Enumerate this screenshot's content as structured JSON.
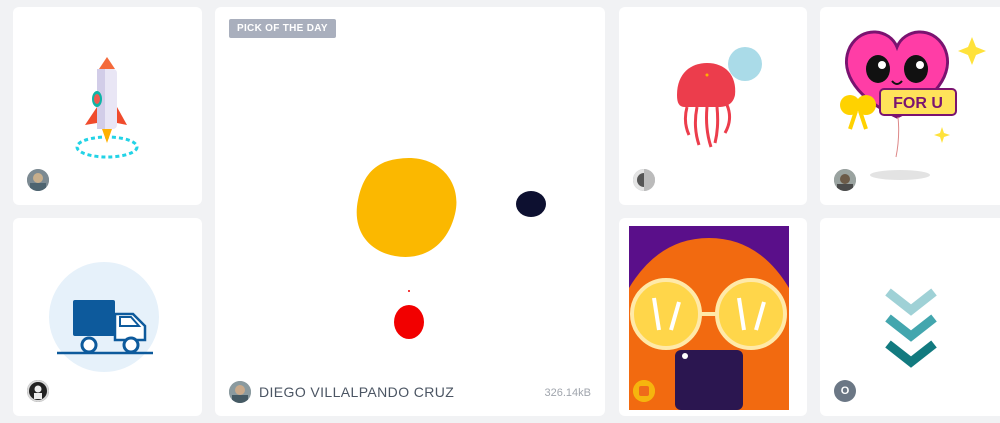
{
  "featured": {
    "badge": "PICK OF THE DAY",
    "author": "DIEGO VILLALPANDO CRUZ",
    "file_size": "326.14kB"
  },
  "cards": [
    {
      "id": "rocket",
      "icon": "rocket-icon"
    },
    {
      "id": "truck",
      "icon": "delivery-truck-icon"
    },
    {
      "id": "jellyfish",
      "icon": "jellyfish-icon"
    },
    {
      "id": "heart",
      "icon": "heart-for-u-icon",
      "text": "FOR U"
    },
    {
      "id": "glasses",
      "icon": "face-with-glasses-icon"
    },
    {
      "id": "chevrons",
      "icon": "chevrons-down-icon"
    }
  ],
  "avatars": {
    "chevrons_letter": "O"
  },
  "colors": {
    "background": "#f1f2f4",
    "card": "#ffffff",
    "badge": "#a9afbd",
    "blob_yellow": "#fbb800",
    "blob_navy": "#0d1030",
    "blob_red": "#f20000"
  }
}
